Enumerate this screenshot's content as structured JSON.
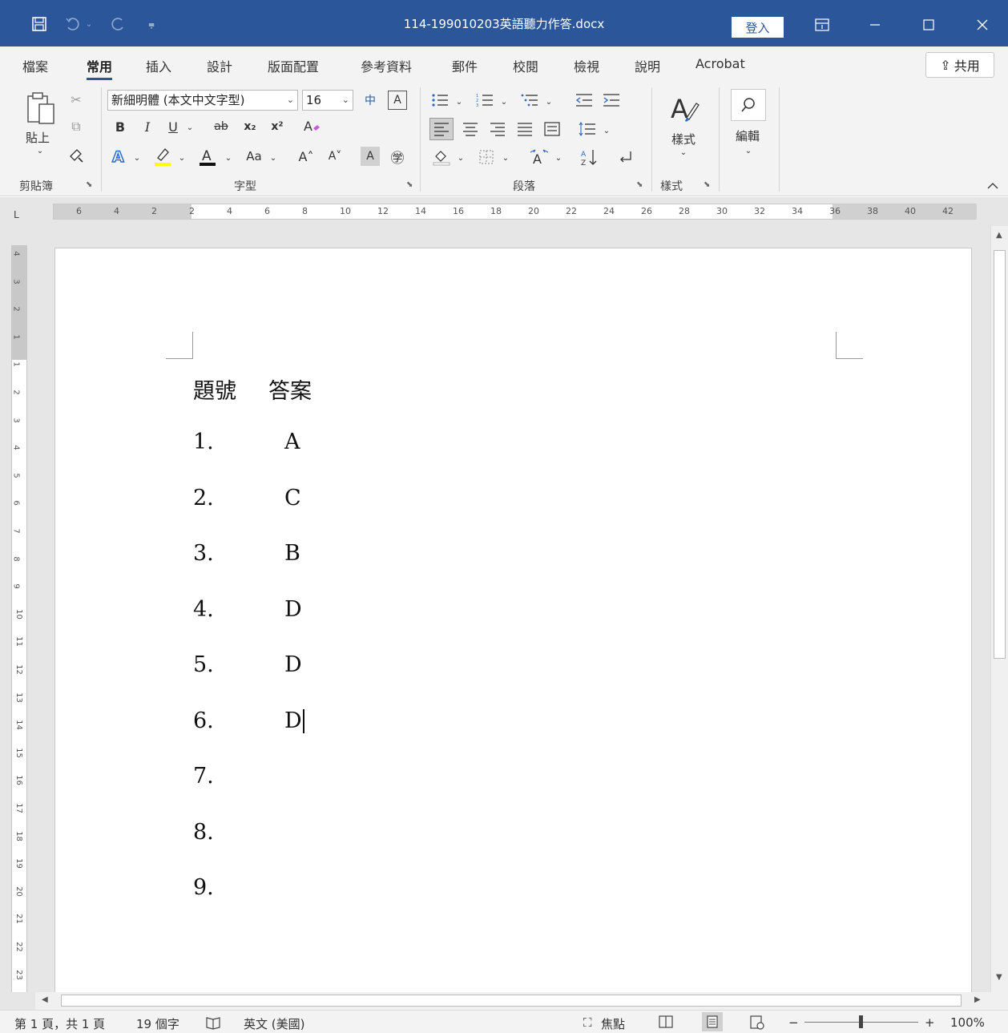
{
  "titlebar": {
    "title": "114-199010203英語聽力作答.docx",
    "signin": "登入",
    "icons": [
      "save-icon",
      "undo-icon",
      "redo-icon",
      "customize-qat-icon",
      "ribbon-display-icon",
      "minimize-icon",
      "maximize-icon",
      "close-icon"
    ]
  },
  "tabs": [
    "檔案",
    "常用",
    "插入",
    "設計",
    "版面配置",
    "參考資料",
    "郵件",
    "校閱",
    "檢視",
    "說明",
    "Acrobat"
  ],
  "share": "共用",
  "ribbon": {
    "paste": "貼上",
    "clipboard": "剪貼簿",
    "font_name": "新細明體 (本文中文字型)",
    "font_size": "16",
    "font_group": "字型",
    "bold": "B",
    "italic": "I",
    "underline": "U",
    "strike": "ab",
    "subscript": "x₂",
    "superscript": "x²",
    "change_case": "Aa",
    "grow": "A˄",
    "shrink": "A˅",
    "shade_a": "A",
    "enclose": "㊫",
    "phonetic": "中",
    "border_a": "A",
    "paragraph_group": "段落",
    "styles": "樣式",
    "styles_group": "樣式",
    "editing": "編輯"
  },
  "ruler": {
    "corner": "L",
    "numbers": [
      "6",
      "4",
      "2",
      "2",
      "4",
      "6",
      "8",
      "10",
      "12",
      "14",
      "16",
      "18",
      "20",
      "22",
      "24",
      "26",
      "28",
      "30",
      "32",
      "34",
      "36",
      "38",
      "40",
      "42"
    ],
    "vnumbers": [
      "4",
      "3",
      "2",
      "1",
      "1",
      "2",
      "3",
      "4",
      "5",
      "6",
      "7",
      "8",
      "9",
      "10",
      "11",
      "12",
      "13",
      "14",
      "15",
      "16",
      "17",
      "18",
      "19",
      "20",
      "21",
      "22",
      "23"
    ]
  },
  "document": {
    "header_no": "題號",
    "header_ans": "答案",
    "rows": [
      {
        "no": "1.",
        "ans": "A"
      },
      {
        "no": "2.",
        "ans": "C"
      },
      {
        "no": "3.",
        "ans": "B"
      },
      {
        "no": "4.",
        "ans": "D"
      },
      {
        "no": "5.",
        "ans": "D"
      },
      {
        "no": "6.",
        "ans": "D"
      },
      {
        "no": "7.",
        "ans": ""
      },
      {
        "no": "8.",
        "ans": ""
      },
      {
        "no": "9.",
        "ans": ""
      }
    ]
  },
  "status": {
    "page": "第 1 頁，共 1 頁",
    "words": "19 個字",
    "language": "英文 (美國)",
    "focus": "焦點",
    "zoom_minus": "−",
    "zoom_plus": "+",
    "zoom": "100%"
  },
  "colors": {
    "accent": "#2b579a"
  }
}
